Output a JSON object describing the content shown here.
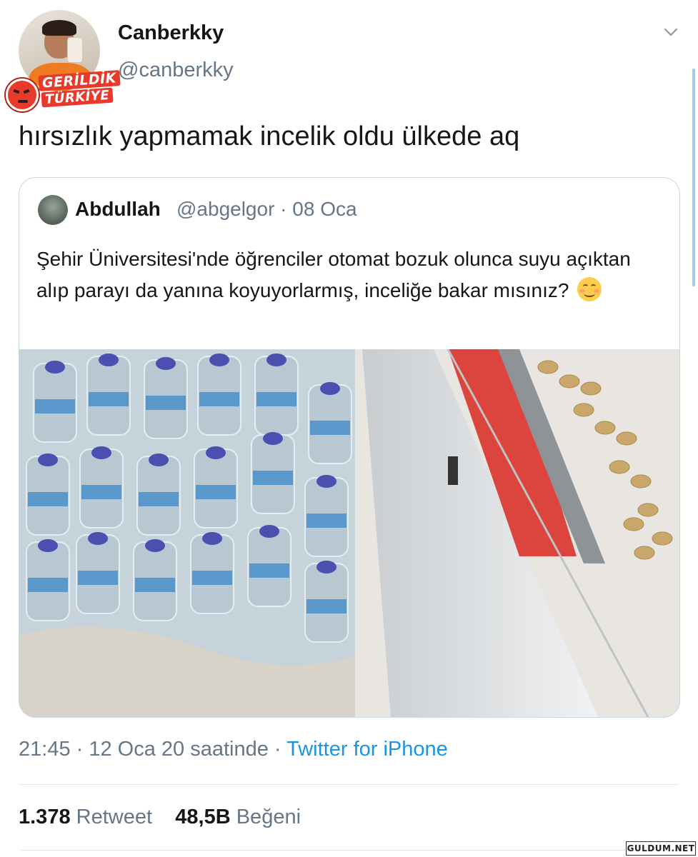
{
  "author": {
    "display_name": "Canberkky",
    "handle": "@canberkky",
    "badge_text_1": "GERİLDİK",
    "badge_text_2": "TÜRKİYE"
  },
  "tweet": {
    "text": "hırsızlık yapmamak incelik oldu ülkede aq",
    "timestamp": "21:45 · 12 Oca 20 saatinde · ",
    "source": "Twitter for iPhone",
    "retweets_count": "1.378",
    "retweets_label": "Retweet",
    "likes_count": "48,5B",
    "likes_label": "Beğeni"
  },
  "quoted_tweet": {
    "display_name": "Abdullah",
    "handle_and_date": "@abgelgor · 08 Oca",
    "text": "Şehir Üniversitesi'nde öğrenciler otomat bozuk olunca suyu açıktan alıp parayı da yanına koyuyorlarmış, inceliğe bakar mısınız?",
    "emoji": "smiling-face-with-smiling-eyes"
  },
  "watermark": "GULDUM.NET",
  "colors": {
    "text_primary": "#14171a",
    "text_secondary": "#657786",
    "link": "#1b95e0",
    "border": "#ccd6dd",
    "badge_red": "#e8392a"
  }
}
